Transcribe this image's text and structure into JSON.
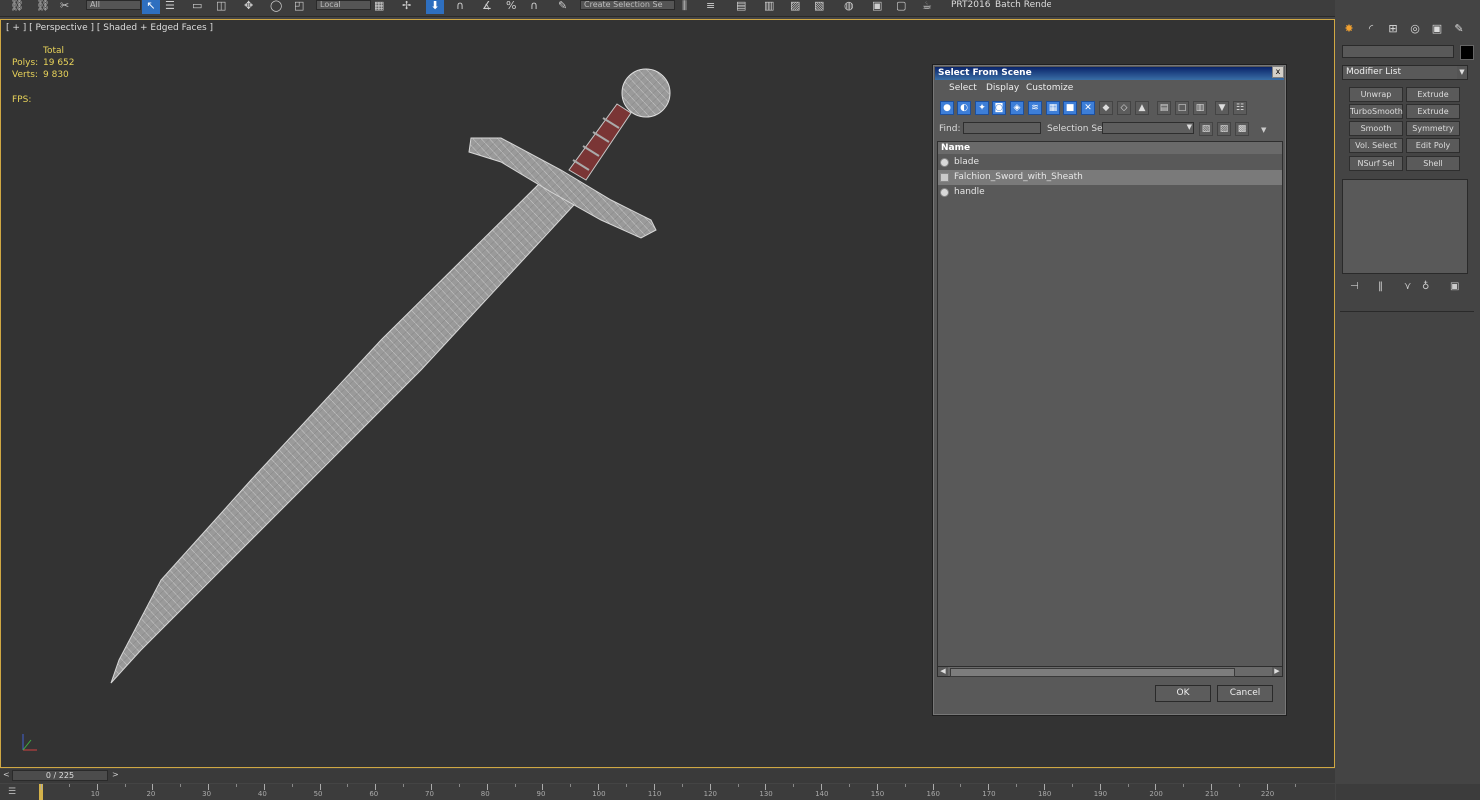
{
  "toolbar": {
    "layer_dropdown": "All",
    "coord_dropdown": "Local",
    "selection_set": "Create Selection Se",
    "plugin_label": "PRT2016",
    "batch_label": "Batch Render..."
  },
  "viewport": {
    "label": "[ + ] [ Perspective ] [ Shaded + Edged Faces ]",
    "stats": {
      "header": "Total",
      "polys_label": "Polys:",
      "polys_value": "19 652",
      "verts_label": "Verts:",
      "verts_value": "9 830",
      "fps_label": "FPS:"
    }
  },
  "dialog": {
    "title": "Select From Scene",
    "close": "x",
    "menu": [
      "Select",
      "Display",
      "Customize"
    ],
    "find_label": "Find:",
    "selection_set_label": "Selection Set:",
    "column_name": "Name",
    "items": [
      {
        "name": "blade",
        "selected": false,
        "type": "object"
      },
      {
        "name": "Falchion_Sword_with_Sheath",
        "selected": true,
        "type": "group"
      },
      {
        "name": "handle",
        "selected": false,
        "type": "object"
      }
    ],
    "ok": "OK",
    "cancel": "Cancel"
  },
  "command_panel": {
    "modifier_list": "Modifier List",
    "modifier_buttons": [
      [
        "Unwrap UVW",
        "Extrude"
      ],
      [
        "TurboSmooth",
        "Extrude"
      ],
      [
        "Smooth",
        "Symmetry"
      ],
      [
        "Vol. Select",
        "Edit Poly"
      ],
      [
        "NSurf Sel",
        "Shell"
      ]
    ]
  },
  "timeline": {
    "frame_display": "0 / 225",
    "prev": "<",
    "next": ">",
    "ticks": [
      "10",
      "20",
      "30",
      "40",
      "50",
      "60",
      "70",
      "80",
      "90",
      "100",
      "110",
      "120",
      "130",
      "140",
      "150",
      "160",
      "170",
      "180",
      "190",
      "200",
      "210",
      "220"
    ]
  }
}
